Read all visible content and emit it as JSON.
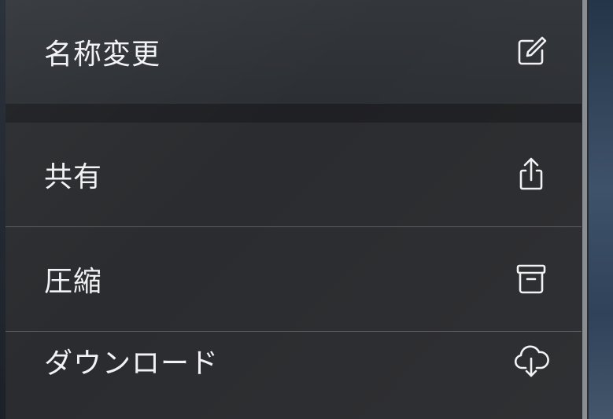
{
  "menu": {
    "items": [
      {
        "label": "名称変更",
        "icon": "square-pencil-icon"
      },
      {
        "label": "共有",
        "icon": "share-icon"
      },
      {
        "label": "圧縮",
        "icon": "archive-box-icon"
      },
      {
        "label": "ダウンロード",
        "icon": "cloud-download-icon"
      }
    ]
  },
  "colors": {
    "text": "#f2f2f4",
    "menu_background": "#2b2c2f",
    "separator": "#5c5e63"
  }
}
